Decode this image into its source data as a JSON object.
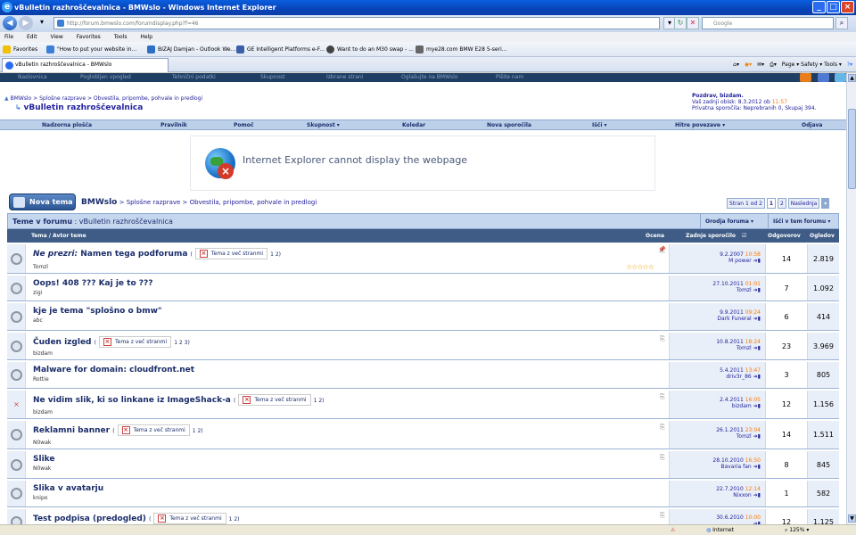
{
  "window": {
    "title": "vBulletin razhroščevalnica - BMWslo - Windows Internet Explorer",
    "buttons": [
      "_",
      "□",
      "×"
    ]
  },
  "address_bar": {
    "url": "http://forum.bmwslo.com/forumdisplay.php?f=46",
    "search_placeholder": "Google"
  },
  "menu": [
    "File",
    "Edit",
    "View",
    "Favorites",
    "Tools",
    "Help"
  ],
  "favorites_bar": {
    "label": "Favorites",
    "items": [
      "\"How to put your website in...",
      "BIZAJ Damjan - Outlook We...",
      "GE Intelligent Platforms e-F...",
      "Want to do an M30 swap - ...",
      "mye28.com BMW E28 5-seri..."
    ]
  },
  "tab": {
    "title": "vBulletin razhroščevalnica - BMWslo",
    "tools": "Page ▾  Safety ▾  Tools ▾"
  },
  "forum_topnav": [
    "Naslovnica",
    "Poglobljen vpogled",
    "Tehnični podatki",
    "Skupnost",
    "Izbrane strani",
    "Oglašujte na BMWslo",
    "Pišite nam"
  ],
  "breadcrumb": "BMWslo > Splošne razprave > Obvestila, pripombe, pohvale in predlogi",
  "forum_title": "vBulletin razhroščevalnica",
  "user_box": {
    "greeting": "Pozdrav, bizdam.",
    "last_visit": "Vaš zadnji obisk: 8.3.2012 ob ",
    "last_visit_time": "11:57",
    "private_messages": "Privatna sporočila: Neprebranih 0, Skupaj 394."
  },
  "navbar": [
    "Nadzorna plošča",
    "Pravilnik",
    "Pomoč",
    "Skupnost ▾",
    "Koledar",
    "Nova sporočila",
    "Išči ▾",
    "Hitre povezave ▾",
    "Odjava"
  ],
  "ie_error": "Internet Explorer cannot display the webpage",
  "new_topic_button": "Nova tema",
  "forum_bar": {
    "site": "BMWslo",
    "path": " > Splošne razprave > Obvestila, pripombe, pohvale in predlogi"
  },
  "pager": {
    "label": "Stran 1 od 2",
    "pages": [
      "1",
      "2"
    ],
    "next": "Naslednja",
    "dropdown": "▾"
  },
  "table": {
    "header_title": "Teme v forumu",
    "header_forum": " : vBulletin razhroščevalnica",
    "tools_button": "Orodja foruma ▾",
    "search_button": "Išči v tem forumu ▾",
    "col_topic": "Tema / Avtor teme",
    "col_rating": "Ocena",
    "col_last_post": "Zadnje sporočilo",
    "col_replies": "Odgovorov",
    "col_views": "Ogledov",
    "multipage_label": "Tema z več stranmi",
    "rows": [
      {
        "title": "Ne prezri: ",
        "subtitle": "Namen tega podforuma",
        "pages": "1 2)",
        "author": "Tomzl",
        "date": "9.2.2007",
        "time": "10:58",
        "last_user": "M power",
        "replies": "14",
        "views": "2.819",
        "stars": "☆☆☆☆☆",
        "pin": "📌"
      },
      {
        "title": "Oops! 408 ??? Kaj je to ???",
        "author": "zigi",
        "date": "27.10.2011",
        "time": "01:01",
        "last_user": "Tomzl",
        "replies": "7",
        "views": "1.092"
      },
      {
        "title": "kje je tema \"splošno o bmw\"",
        "author": "abc",
        "date": "9.9.2011",
        "time": "09:24",
        "last_user": "Dark Funeral",
        "replies": "6",
        "views": "414"
      },
      {
        "title": "Čuden izgled",
        "pages": "1 2 3)",
        "author": "bizdam",
        "date": "10.8.2011",
        "time": "18:24",
        "last_user": "Tomzl",
        "replies": "23",
        "views": "3.969"
      },
      {
        "title": "Malware for domain: cloudfront.net",
        "author": "Rottie",
        "date": "5.4.2011",
        "time": "13:47",
        "last_user": "driv3r_86",
        "replies": "3",
        "views": "805"
      },
      {
        "title": "Ne vidim slik, ki so linkane iz ImageShack-a",
        "pages": "1 2)",
        "author": "bizdam",
        "date": "2.4.2011",
        "time": "16:05",
        "last_user": "bizdam",
        "replies": "12",
        "views": "1.156"
      },
      {
        "title": "Reklamni banner",
        "pages": "1 2)",
        "author": "N0wak",
        "date": "26.1.2011",
        "time": "23:04",
        "last_user": "Tomzl",
        "replies": "14",
        "views": "1.511"
      },
      {
        "title": "Slike",
        "author": "N0wak",
        "date": "28.10.2010",
        "time": "16:50",
        "last_user": "Bavaria fan",
        "replies": "8",
        "views": "845"
      },
      {
        "title": "Slika v avatarju",
        "author": "knipo",
        "date": "22.7.2010",
        "time": "12:14",
        "last_user": "Nixxon",
        "replies": "1",
        "views": "582"
      },
      {
        "title": "Test podpisa (predogled)",
        "pages": "1 2)",
        "author": "",
        "date": "30.6.2010",
        "time": "10:00",
        "last_user": "",
        "replies": "12",
        "views": "1.125"
      }
    ]
  },
  "status_bar": {
    "zone": "Internet",
    "zoom": "125%"
  }
}
